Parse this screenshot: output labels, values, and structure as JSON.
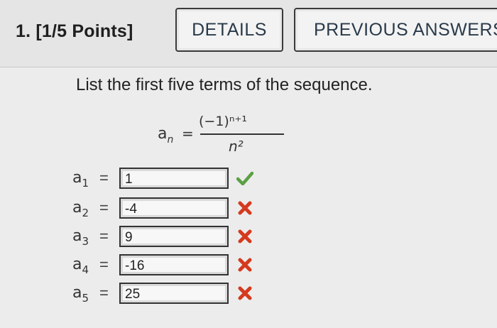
{
  "header": {
    "question_number": "1. [1/5 Points]",
    "details_label": "DETAILS",
    "previous_answers_label": "PREVIOUS ANSWERS"
  },
  "prompt": "List the first five terms of the sequence.",
  "formula": {
    "lhs": "a",
    "lhs_subscript": "n",
    "equals": "=",
    "numerator": "(−1)ⁿ⁺¹",
    "denominator": "n²"
  },
  "answers": [
    {
      "term": "a",
      "sub": "1",
      "equals": "=",
      "value": "1",
      "status": "correct",
      "icon": "check-icon"
    },
    {
      "term": "a",
      "sub": "2",
      "equals": "=",
      "value": "-4",
      "status": "incorrect",
      "icon": "x-icon"
    },
    {
      "term": "a",
      "sub": "3",
      "equals": "=",
      "value": "9",
      "status": "incorrect",
      "icon": "x-icon"
    },
    {
      "term": "a",
      "sub": "4",
      "equals": "=",
      "value": "-16",
      "status": "incorrect",
      "icon": "x-icon"
    },
    {
      "term": "a",
      "sub": "5",
      "equals": "=",
      "value": "25",
      "status": "incorrect",
      "icon": "x-icon"
    }
  ],
  "colors": {
    "correct": "#5aa043",
    "incorrect": "#d43a1f"
  }
}
